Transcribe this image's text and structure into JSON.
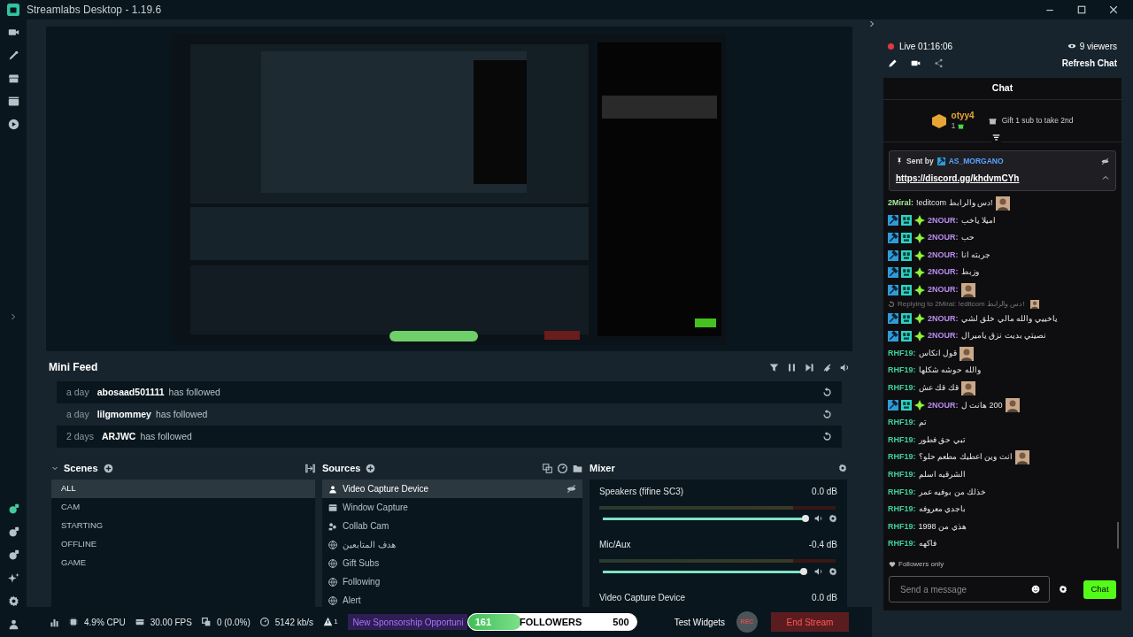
{
  "window": {
    "title": "Streamlabs Desktop - 1.19.6"
  },
  "mini_feed": {
    "title": "Mini Feed",
    "events": [
      {
        "time": "a day",
        "user": "abosaad501111",
        "action": "has followed"
      },
      {
        "time": "a day",
        "user": "lilgmommey",
        "action": "has followed"
      },
      {
        "time": "2 days",
        "user": "ARJWC",
        "action": "has followed"
      }
    ]
  },
  "scenes": {
    "title": "Scenes",
    "items": [
      {
        "label": "ALL",
        "selected": true
      },
      {
        "label": "CAM",
        "selected": false
      },
      {
        "label": "STARTING",
        "selected": false
      },
      {
        "label": "OFFLINE",
        "selected": false
      },
      {
        "label": "GAME",
        "selected": false
      }
    ]
  },
  "sources": {
    "title": "Sources",
    "items": [
      {
        "label": "Video Capture Device",
        "kind": "camera",
        "selected": true
      },
      {
        "label": "Window Capture",
        "kind": "window",
        "selected": false
      },
      {
        "label": "Collab Cam",
        "kind": "collab",
        "selected": false
      },
      {
        "label": "هدف المتابعين",
        "kind": "browser",
        "selected": false
      },
      {
        "label": "Gift Subs",
        "kind": "browser",
        "selected": false
      },
      {
        "label": "Following",
        "kind": "browser",
        "selected": false
      },
      {
        "label": "Alert",
        "kind": "browser",
        "selected": false
      }
    ]
  },
  "mixer": {
    "title": "Mixer",
    "channels": [
      {
        "name": "Speakers (fifine SC3)",
        "reading": "0.0 dB",
        "level": 1.0
      },
      {
        "name": "Mic/Aux",
        "reading": "-0.4 dB",
        "level": 0.99
      },
      {
        "name": "Video Capture Device",
        "reading": "0.0 dB"
      }
    ]
  },
  "status_bar": {
    "cpu": "4.9% CPU",
    "fps": "30.00 FPS",
    "dropped": "0 (0.0%)",
    "bitrate": "5142 kb/s",
    "alerts": "1",
    "sponsorship": "New Sponsorship Opportuni",
    "goal": {
      "current": "161",
      "label": "FOLLOWERS",
      "target": "500",
      "level": 0.32
    },
    "test_widgets": "Test Widgets",
    "rec": "REC",
    "end_stream": "End Stream"
  },
  "chat": {
    "live": "Live 01:16:06",
    "viewers": "9 viewers",
    "refresh": "Refresh Chat",
    "title": "Chat",
    "top_gifter": {
      "user": "otyy4",
      "count": "1",
      "prompt": "Gift 1 sub to take 2nd"
    },
    "pinned": {
      "sent_by": "Sent by",
      "user": "AS_MORGANO",
      "link": "https://discord.gg/khdvmCYh"
    },
    "messages": [
      {
        "kind": "message",
        "badges": false,
        "user": "2Miral:",
        "color": "#a3e79b",
        "text": "!editcom دس والرابط!",
        "emote": true
      },
      {
        "kind": "message",
        "badges": true,
        "user": "2NOUR:",
        "color": "#b98cf0",
        "text": "اميلا ياخب",
        "emote": false
      },
      {
        "kind": "message",
        "badges": true,
        "user": "2NOUR:",
        "color": "#b98cf0",
        "text": "حب",
        "emote": false
      },
      {
        "kind": "message",
        "badges": true,
        "user": "2NOUR:",
        "color": "#b98cf0",
        "text": "جربته انا",
        "emote": false
      },
      {
        "kind": "message",
        "badges": true,
        "user": "2NOUR:",
        "color": "#b98cf0",
        "text": "وزبط",
        "emote": false
      },
      {
        "kind": "message",
        "badges": true,
        "user": "2NOUR:",
        "color": "#b98cf0",
        "emote": true
      },
      {
        "kind": "reply",
        "text": "Replying to 2Miral: !editcom دس والرابط!",
        "emote": true
      },
      {
        "kind": "message",
        "badges": true,
        "user": "2NOUR:",
        "color": "#b98cf0",
        "text": "ياخييي والله مالي خلق لشي",
        "emote": false
      },
      {
        "kind": "message",
        "badges": true,
        "user": "2NOUR:",
        "color": "#b98cf0",
        "text": "نصيتي بديت نزق ياميرال",
        "emote": false
      },
      {
        "kind": "message",
        "badges": false,
        "user": "RHF19:",
        "color": "#3fcf9a",
        "text": "قول انكاس",
        "emote": true
      },
      {
        "kind": "message",
        "badges": false,
        "user": "RHF19:",
        "color": "#3fcf9a",
        "text": "والله حوشه شكلها",
        "emote": false
      },
      {
        "kind": "message",
        "badges": false,
        "user": "RHF19:",
        "color": "#3fcf9a",
        "text": "قك قك عش",
        "emote": true
      },
      {
        "kind": "message",
        "badges": true,
        "user": "2NOUR:",
        "color": "#b98cf0",
        "text": "200 هانت ل",
        "emote": true
      },
      {
        "kind": "message",
        "badges": false,
        "user": "RHF19:",
        "color": "#3fcf9a",
        "text": "تم",
        "emote": false
      },
      {
        "kind": "message",
        "badges": false,
        "user": "RHF19:",
        "color": "#3fcf9a",
        "text": "تبي حق فطور",
        "emote": false
      },
      {
        "kind": "message",
        "badges": false,
        "user": "RHF19:",
        "color": "#3fcf9a",
        "text": "انت وين اعطيك مطعم حلو؟",
        "emote": true
      },
      {
        "kind": "message",
        "badges": false,
        "user": "RHF19:",
        "color": "#3fcf9a",
        "text": "الشرقيه اسلم",
        "emote": false
      },
      {
        "kind": "message",
        "badges": false,
        "user": "RHF19:",
        "color": "#3fcf9a",
        "text": "خذلك من بوفيه عمر",
        "emote": false
      },
      {
        "kind": "message",
        "badges": false,
        "user": "RHF19:",
        "color": "#3fcf9a",
        "text": "باجدي معروفه",
        "emote": false
      },
      {
        "kind": "message",
        "badges": false,
        "user": "RHF19:",
        "color": "#3fcf9a",
        "text": "هذي من 1998",
        "emote": false
      },
      {
        "kind": "message",
        "badges": false,
        "user": "RHF19:",
        "color": "#3fcf9a",
        "text": "فاكهه",
        "emote": false
      }
    ],
    "followers_only": "Followers only",
    "input": {
      "placeholder": "Send a message"
    },
    "send": "Chat"
  }
}
